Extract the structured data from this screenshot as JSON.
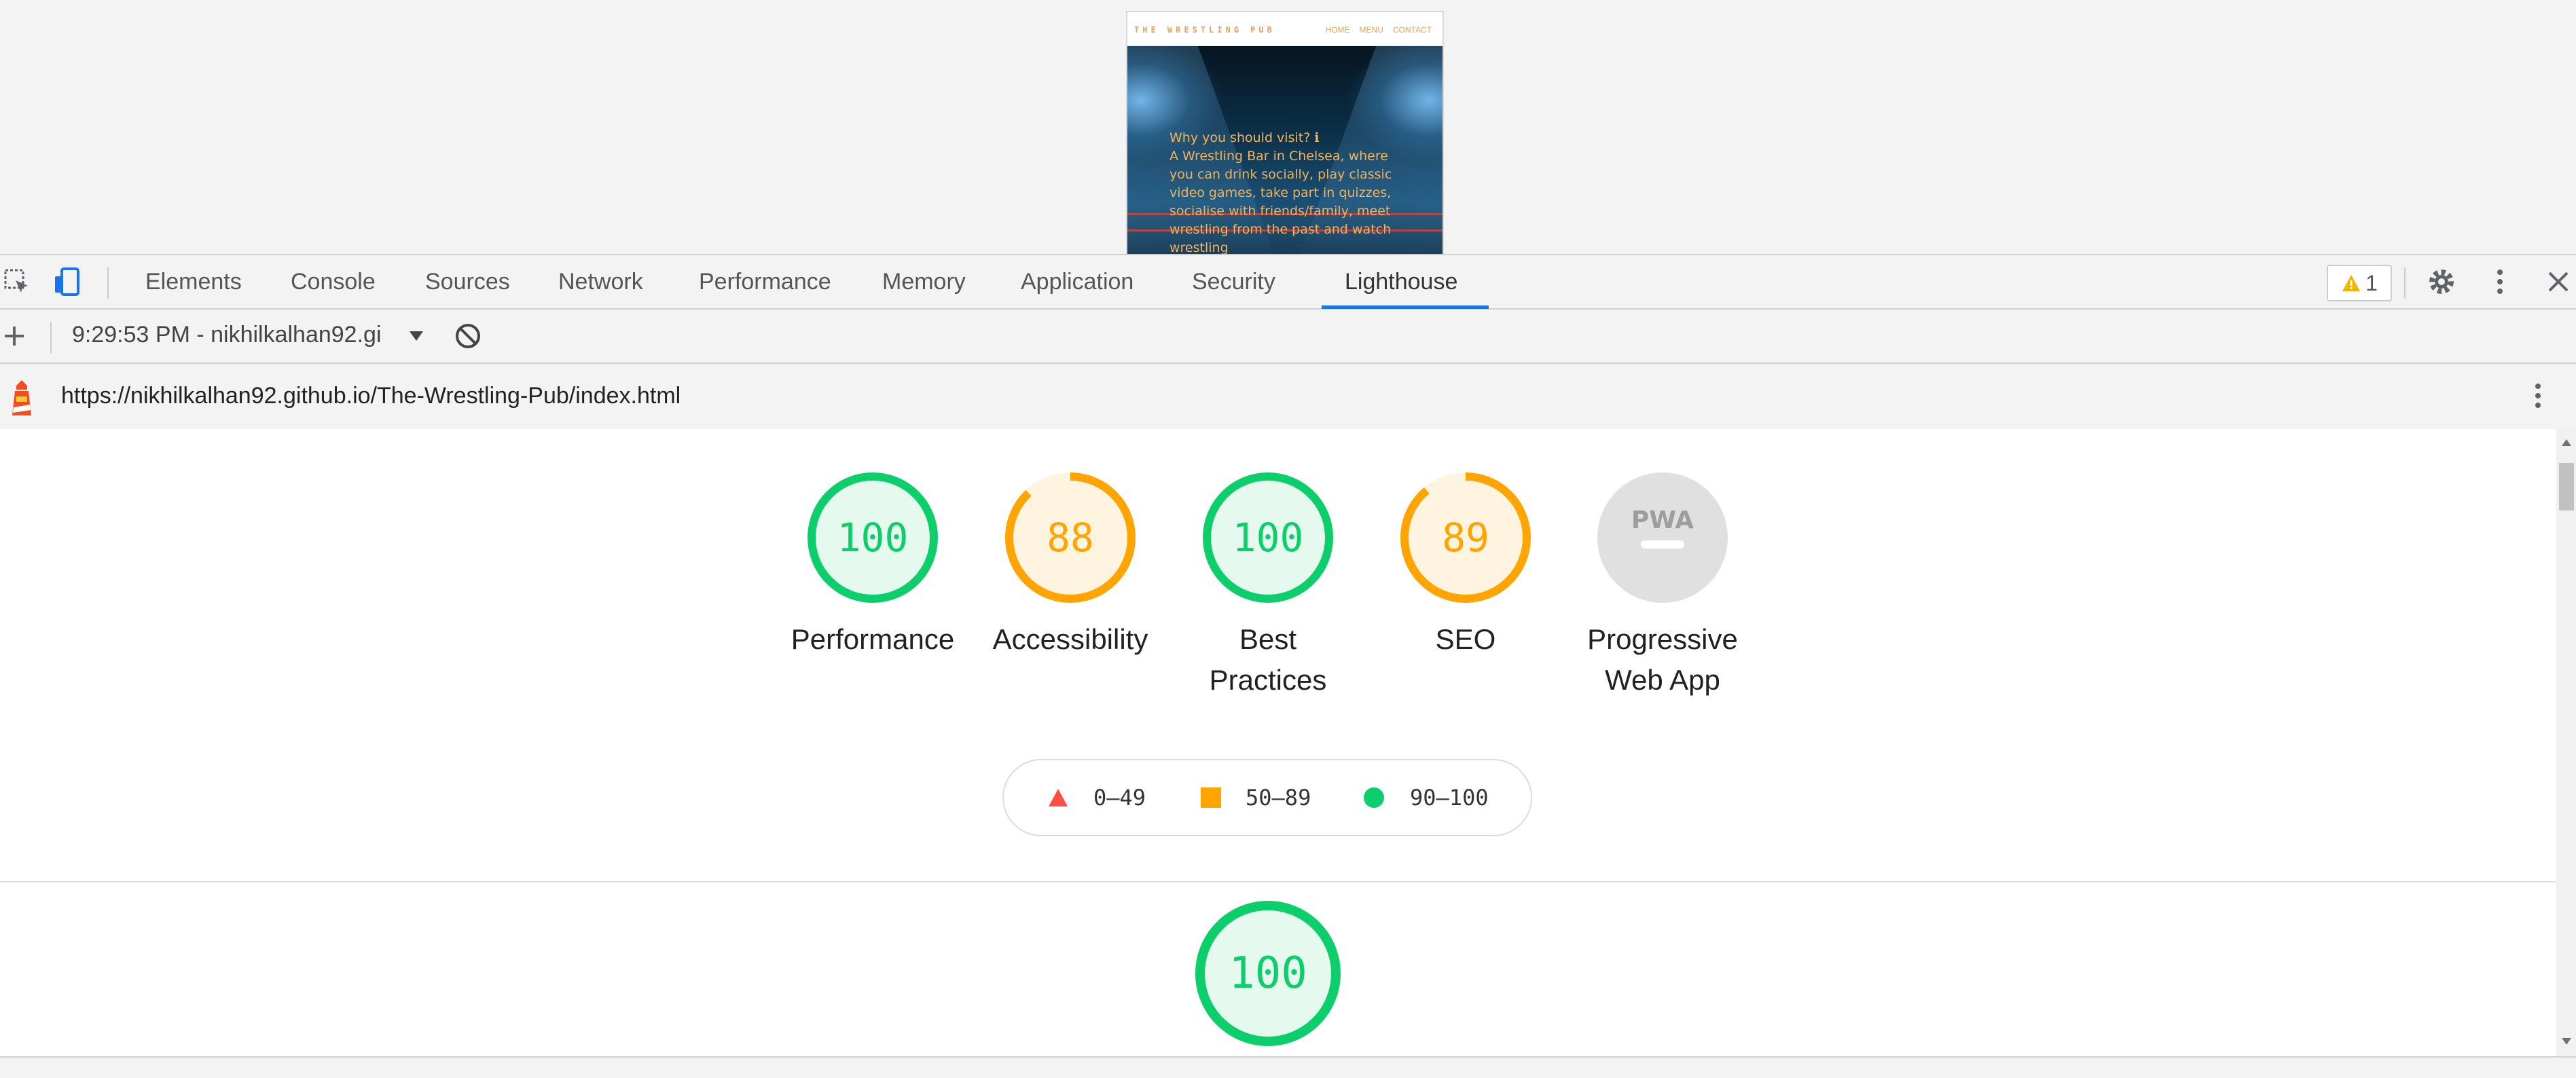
{
  "preview": {
    "site_logo": "THE WRESTLING PUB",
    "nav": [
      "HOME",
      "MENU",
      "CONTACT"
    ],
    "hero_lines": [
      "Why you should visit? ℹ",
      "A Wrestling Bar in Chelsea, where",
      "you can drink socially, play classic",
      "video games, take part in quizzes,",
      "socialise with friends/family, meet",
      "wrestling from the past and watch",
      "wrestling"
    ]
  },
  "devtools": {
    "tabs": [
      "Elements",
      "Console",
      "Sources",
      "Network",
      "Performance",
      "Memory",
      "Application",
      "Security",
      "Lighthouse"
    ],
    "active_tab": "Lighthouse",
    "warnings_count": "1",
    "report_selector": "9:29:53 PM - nikhilkalhan92.gi",
    "report_url": "https://nikhilkalhan92.github.io/The-Wrestling-Pub/index.html"
  },
  "scores": [
    {
      "value": "100",
      "label1": "Performance",
      "label2": "",
      "score": 1.0,
      "status": "pass"
    },
    {
      "value": "88",
      "label1": "Accessibility",
      "label2": "",
      "score": 0.88,
      "status": "average"
    },
    {
      "value": "100",
      "label1": "Best",
      "label2": "Practices",
      "score": 1.0,
      "status": "pass"
    },
    {
      "value": "89",
      "label1": "SEO",
      "label2": "",
      "score": 0.89,
      "status": "average"
    },
    {
      "value": "",
      "label1": "Progressive",
      "label2": "Web App",
      "score": null,
      "status": "na",
      "badge": "PWA"
    }
  ],
  "legend": {
    "fail": "0–49",
    "average": "50–89",
    "pass": "90–100"
  },
  "detail_score": {
    "value": "100",
    "score": 1.0,
    "status": "pass"
  },
  "colors": {
    "pass": "#0cce6b",
    "pass_fill": "#e6f9ee",
    "average": "#ffa400",
    "average_fill": "#fff4e0",
    "fail": "#ff4e42",
    "na": "#e0e0e0",
    "accent": "#1a73e8"
  }
}
